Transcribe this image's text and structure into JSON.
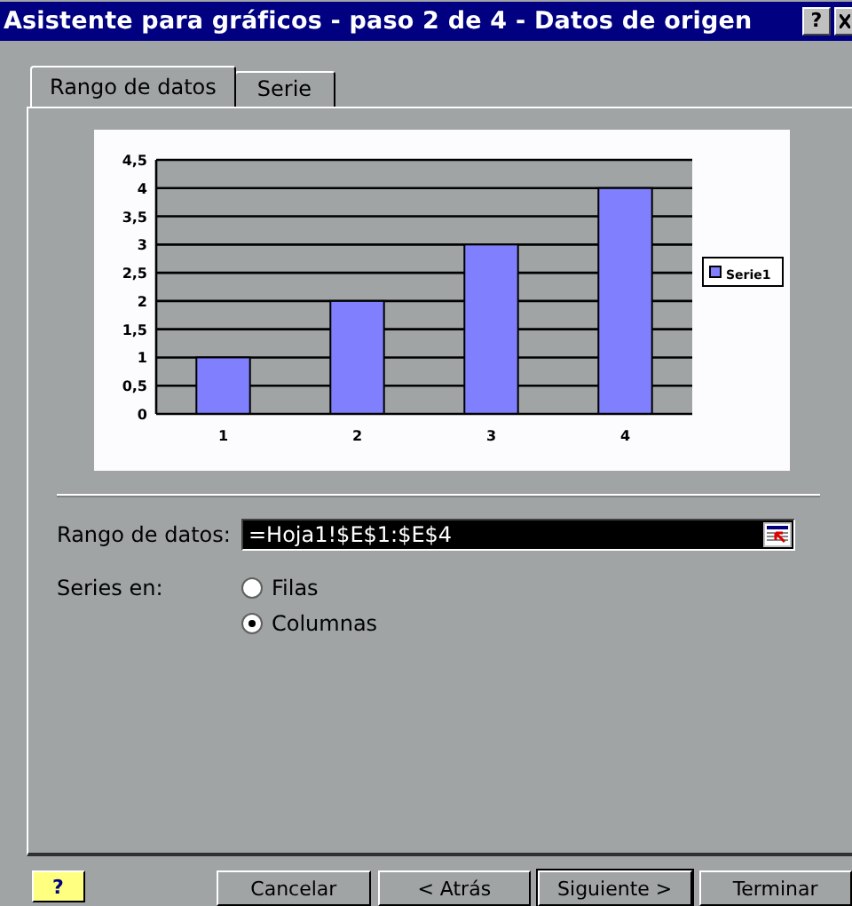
{
  "window": {
    "title": "Asistente para gráficos - paso 2 de 4 - Datos de origen",
    "help_button": "?"
  },
  "tabs": [
    {
      "label": "Rango de datos",
      "selected": true
    },
    {
      "label": "Serie",
      "selected": false
    }
  ],
  "chart": {
    "chart_data": {
      "type": "bar",
      "categories": [
        "1",
        "2",
        "3",
        "4"
      ],
      "series": [
        {
          "name": "Serie1",
          "color": "#8080ff",
          "values": [
            1,
            2,
            3,
            4
          ]
        }
      ],
      "ylim": [
        0,
        4.5
      ],
      "grid": true,
      "yticks": [
        {
          "value": 0,
          "label": "0"
        },
        {
          "value": 0.5,
          "label": "0,5"
        },
        {
          "value": 1,
          "label": "1"
        },
        {
          "value": 1.5,
          "label": "1,5"
        },
        {
          "value": 2,
          "label": "2"
        },
        {
          "value": 2.5,
          "label": "2,5"
        },
        {
          "value": 3,
          "label": "3"
        },
        {
          "value": 3.5,
          "label": "3,5"
        },
        {
          "value": 4,
          "label": "4"
        },
        {
          "value": 4.5,
          "label": "4,5"
        }
      ]
    }
  },
  "range": {
    "label": "Rango de datos:",
    "value": "=Hoja1!$E$1:$E$4"
  },
  "series_in": {
    "label": "Series en:",
    "options": [
      {
        "label": "Filas",
        "selected": false
      },
      {
        "label": "Columnas",
        "selected": true
      }
    ]
  },
  "help_icon_button": "?",
  "buttons": [
    {
      "label": "Cancelar",
      "default": false
    },
    {
      "label": "< Atrás",
      "default": false
    },
    {
      "label": "Siguiente >",
      "default": true
    },
    {
      "label": "Terminar",
      "default": false
    }
  ]
}
